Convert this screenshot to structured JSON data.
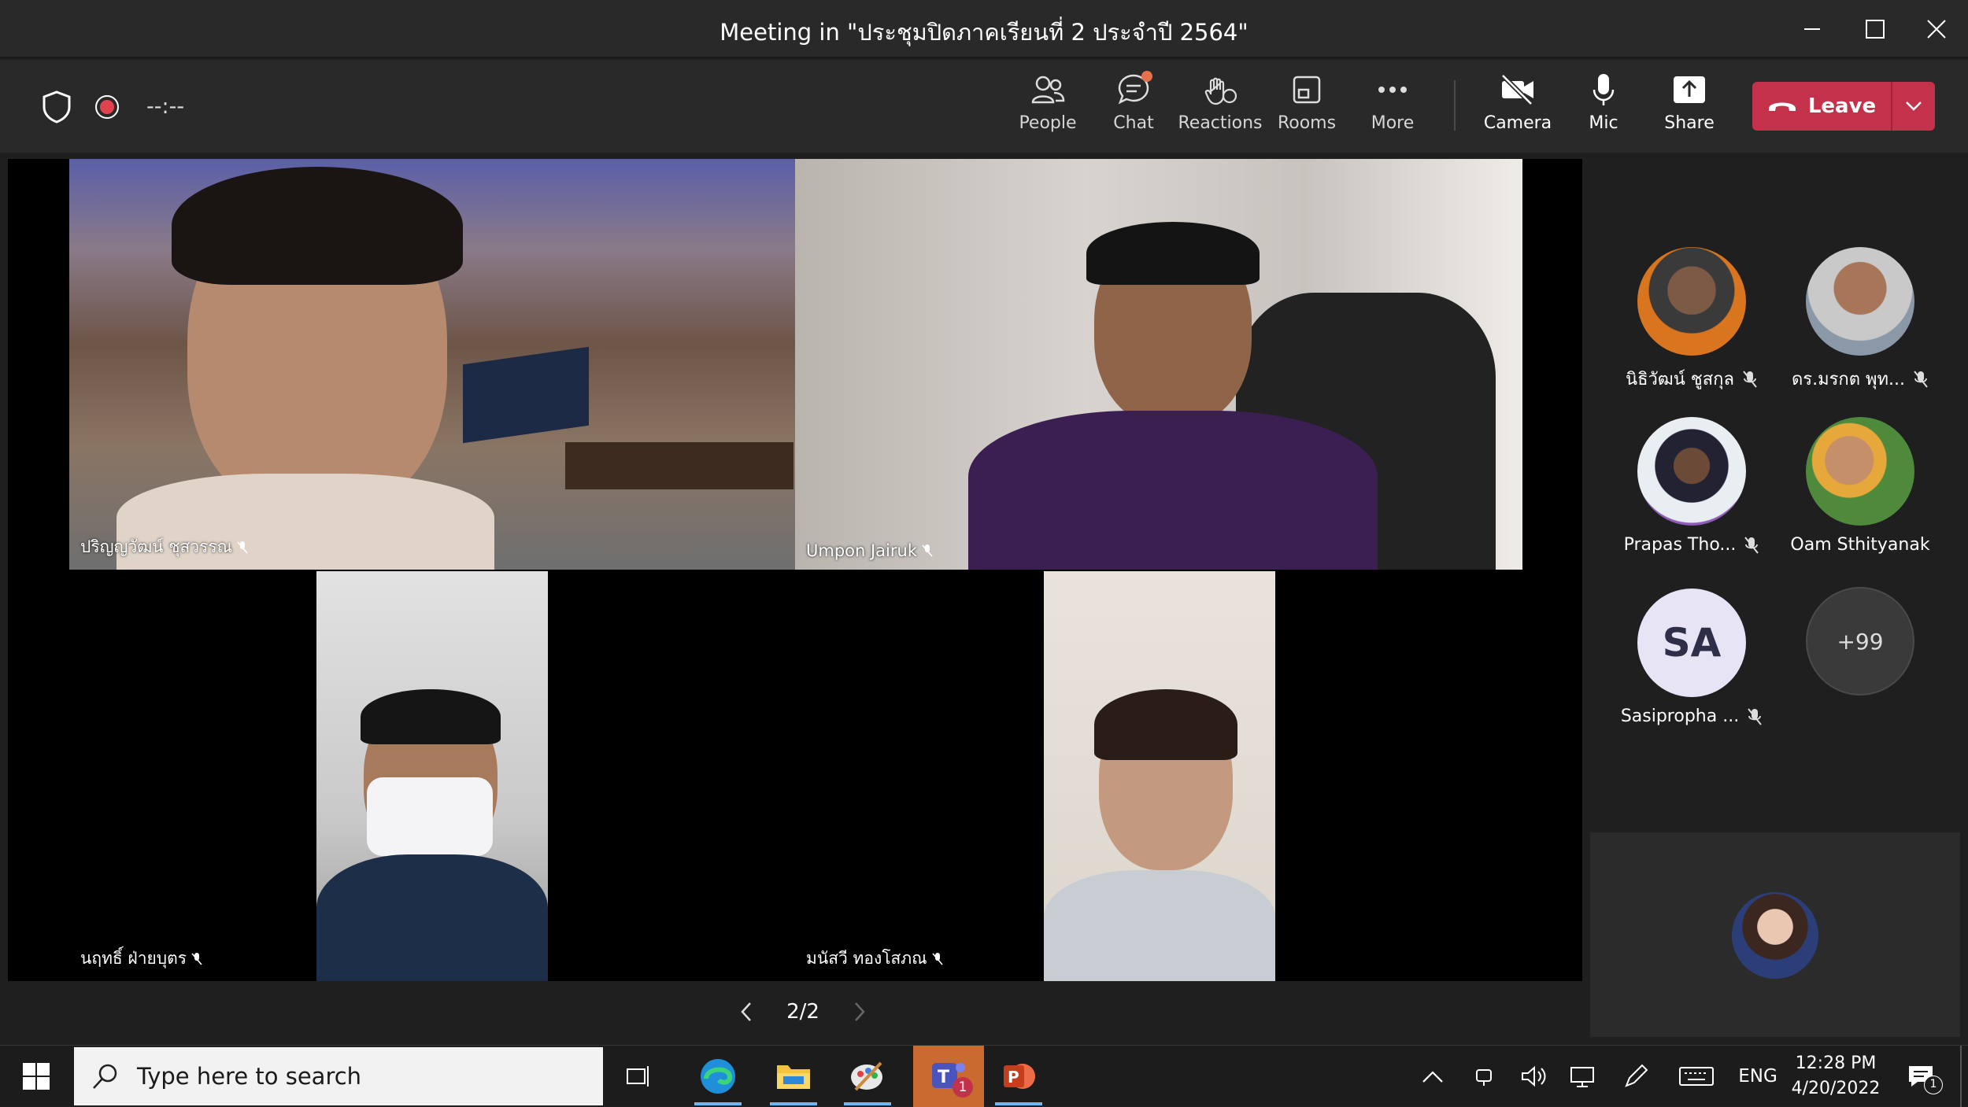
{
  "window": {
    "title": "Meeting in \"ประชุมปิดภาคเรียนที่ 2 ประจำปี 2564\""
  },
  "toolbar": {
    "timer": "--:--",
    "buttons": [
      {
        "label": "People",
        "icon": "people-icon"
      },
      {
        "label": "Chat",
        "icon": "chat-icon"
      },
      {
        "label": "Reactions",
        "icon": "reactions-icon"
      },
      {
        "label": "Rooms",
        "icon": "rooms-icon"
      },
      {
        "label": "More",
        "icon": "more-icon"
      },
      {
        "label": "Camera",
        "icon": "camera-off-icon"
      },
      {
        "label": "Mic",
        "icon": "mic-icon"
      },
      {
        "label": "Share",
        "icon": "share-icon"
      }
    ],
    "leave_label": "Leave"
  },
  "stage": {
    "tiles": [
      {
        "name": "ปริญญวัฒน์ ชุสวรรณ"
      },
      {
        "name": "Umpon Jairuk"
      },
      {
        "name": "นฤทธิ์ ฝ่ายบุตร"
      },
      {
        "name": "มนัสวี ทองโสภณ"
      }
    ],
    "pager": "2/2"
  },
  "sidebar": {
    "participants": [
      {
        "name": "นิธิวัฒน์ ชูสกุล",
        "muted": true
      },
      {
        "name": "ดร.มรกต พุท...",
        "muted": true
      },
      {
        "name": "Prapas Tho...",
        "muted": true
      },
      {
        "name": "Oam Sthityanak",
        "muted": false
      },
      {
        "name": "Sasipropha ...",
        "initials": "SA",
        "muted": true
      }
    ],
    "overflow": "+99"
  },
  "taskbar": {
    "search_placeholder": "Type here to search",
    "teams_badge": "1",
    "language": "ENG",
    "time": "12:28 PM",
    "date": "4/20/2022",
    "notifications": "1"
  },
  "colors": {
    "leave": "#c4314b",
    "record": "#e0434f",
    "chat_badge": "#e8704a",
    "sa_avatar": "#e6e4f5"
  }
}
